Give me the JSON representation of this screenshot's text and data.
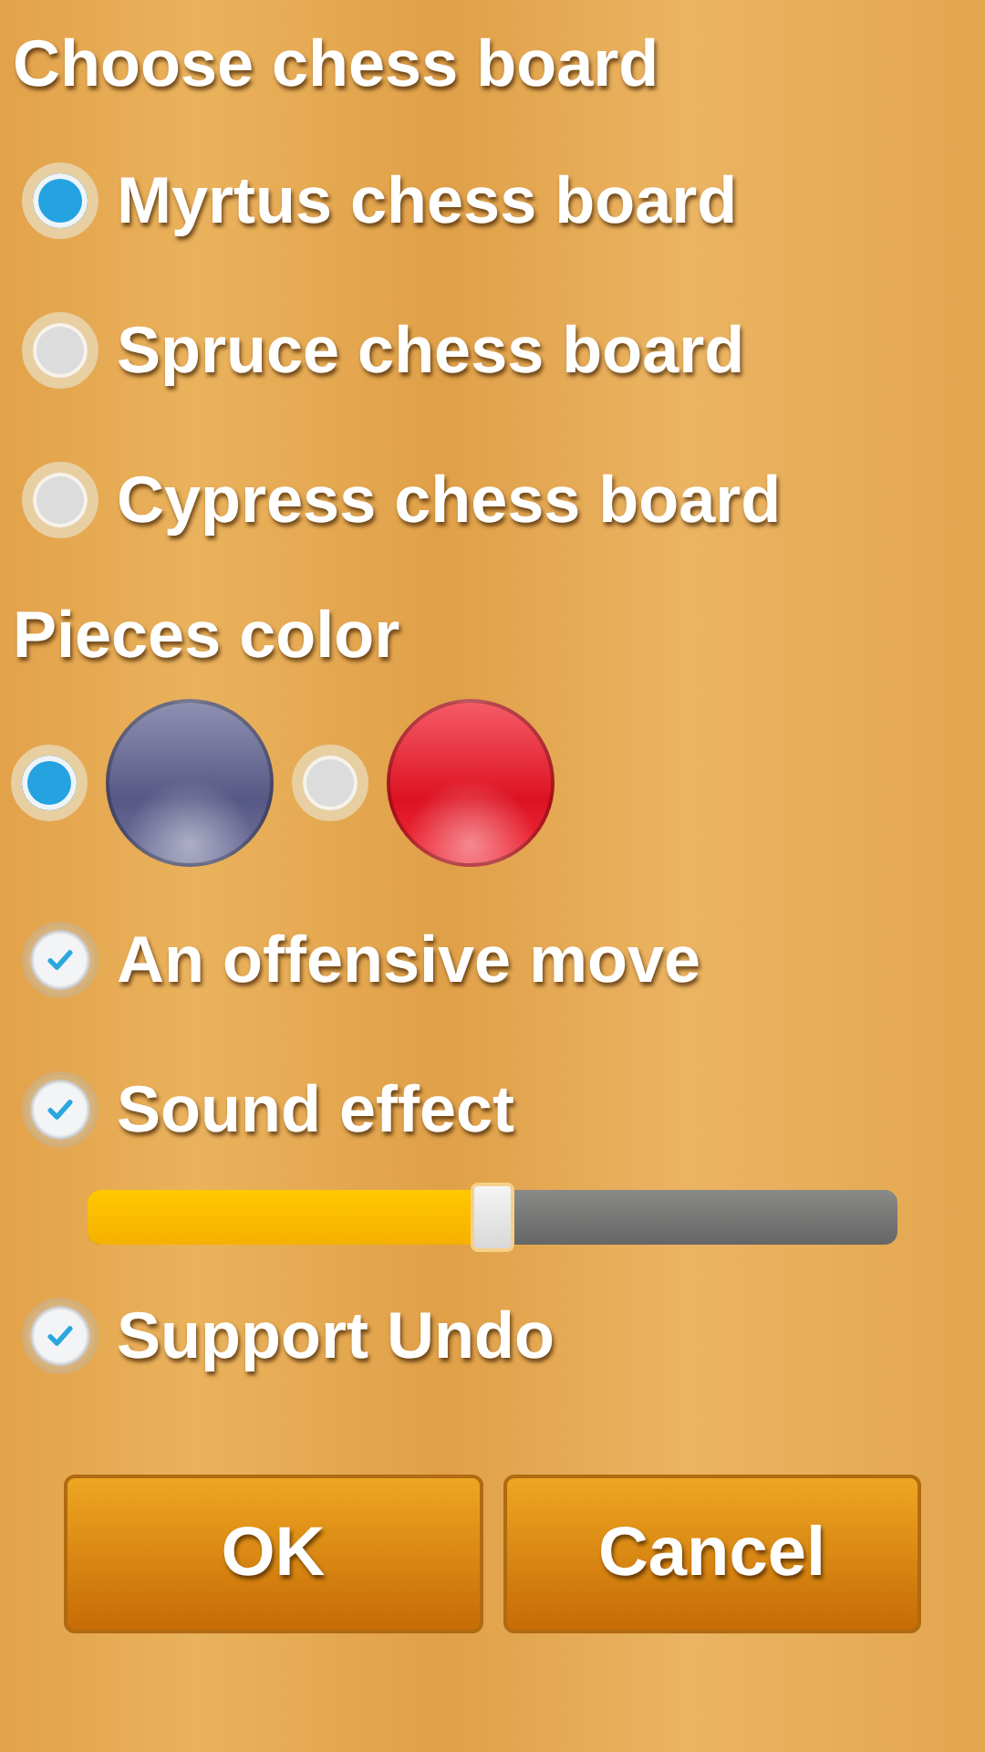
{
  "board_heading": "Choose chess board",
  "boards": [
    {
      "label": "Myrtus chess board",
      "selected": true
    },
    {
      "label": "Spruce chess board",
      "selected": false
    },
    {
      "label": "Cypress chess board",
      "selected": false
    }
  ],
  "pieces_heading": "Pieces color",
  "piece_colors": [
    {
      "color": "#5e6090",
      "selected": true
    },
    {
      "color": "#f01424",
      "selected": false
    }
  ],
  "options": [
    {
      "kind": "checkbox",
      "label": "An offensive move",
      "checked": true
    },
    {
      "kind": "checkbox",
      "label": "Sound effect",
      "checked": true
    },
    {
      "kind": "slider",
      "level": 0.5
    },
    {
      "kind": "checkbox",
      "label": "Support Undo",
      "checked": true
    }
  ],
  "buttons": [
    "OK",
    "Cancel"
  ]
}
